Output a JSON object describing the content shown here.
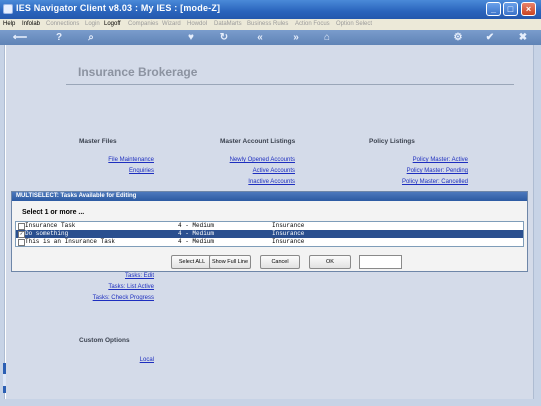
{
  "window": {
    "title": "IES Navigator Client v8.03 : My IES :     [mode-Z]",
    "controls": [
      "_",
      "□",
      "×"
    ]
  },
  "menu": {
    "items": [
      {
        "label": "Help",
        "enabled": true
      },
      {
        "label": "Infolab",
        "enabled": true
      },
      {
        "label": "Connections",
        "enabled": false
      },
      {
        "label": "Login",
        "enabled": false
      },
      {
        "label": "Logoff",
        "enabled": true
      },
      {
        "label": "Companies",
        "enabled": false
      },
      {
        "label": "Wizard",
        "enabled": false
      },
      {
        "label": "HowdoI",
        "enabled": false
      },
      {
        "label": "DataMarts",
        "enabled": false
      },
      {
        "label": "Business Rules",
        "enabled": false
      },
      {
        "label": "Action Focus",
        "enabled": false
      },
      {
        "label": "Option Select",
        "enabled": false
      }
    ]
  },
  "toolbar": {
    "icons": [
      "back-icon",
      "help-icon",
      "search-icon",
      "favorite-icon",
      "refresh-icon",
      "previous-icon",
      "next-icon",
      "home-icon",
      "settings-icon",
      "ok-icon",
      "close-icon"
    ],
    "glyphs": [
      "⟵",
      "?",
      "⌕",
      "♥",
      "↻",
      "«",
      "»",
      "⌂",
      "⚙",
      "✔",
      "✖"
    ]
  },
  "page": {
    "title": "Insurance Brokerage",
    "sections": {
      "master_files": {
        "heading": "Master Files",
        "links": [
          "File Maintenance",
          "Enquiries"
        ]
      },
      "master_accounts": {
        "heading": "Master Account Listings",
        "links": [
          "Newly Opened Accounts",
          "Active Accounts",
          "Inactive Accounts"
        ]
      },
      "policy_listings": {
        "heading": "Policy Listings",
        "links": [
          "Policy Master: Active",
          "Policy Master: Pending",
          "Policy Master: Cancelled"
        ]
      },
      "tasks": {
        "links": [
          "Tasks: Edit",
          "Tasks: List Active",
          "Tasks: Check Progress"
        ]
      },
      "custom_options": {
        "heading": "Custom Options",
        "links": [
          "Local"
        ]
      }
    }
  },
  "modal": {
    "title": "MULTISELECT: Tasks Available for Editing",
    "prompt": "Select 1 or more ...",
    "rows": [
      {
        "checked": false,
        "selected": false,
        "name": "Insurance Task",
        "priority": "4 - Medium",
        "category": "Insurance"
      },
      {
        "checked": true,
        "selected": true,
        "name": "Do something",
        "priority": "4 - Medium",
        "category": "Insurance"
      },
      {
        "checked": false,
        "selected": false,
        "name": "This is an Insurance Task",
        "priority": "4 - Medium",
        "category": "Insurance"
      }
    ],
    "buttons": {
      "select_all": "Select ALL",
      "show_full_line": "Show Full Line",
      "cancel": "Cancel",
      "ok": "OK"
    },
    "field_value": ""
  },
  "colors": {
    "titlebar": "#2a64bc",
    "page_background": "#d4dbe9",
    "link": "#1d2ebf",
    "selected_row": "#2a4f8f"
  }
}
